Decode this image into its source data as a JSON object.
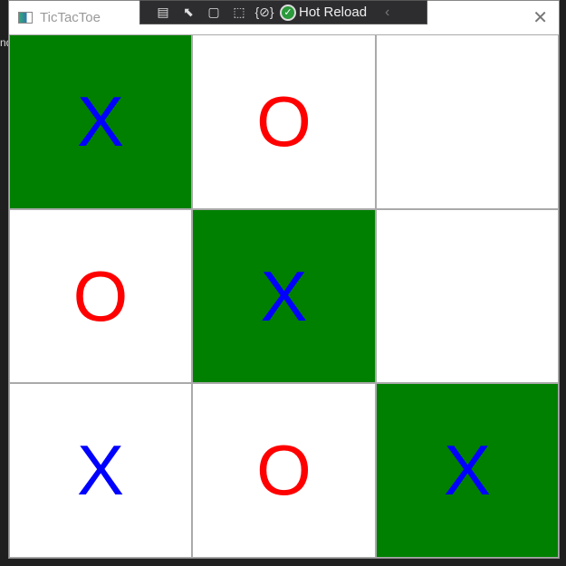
{
  "window": {
    "title": "TicTacToe",
    "close": "✕"
  },
  "background_text": "nd",
  "toolbar": {
    "hot_reload": "Hot Reload",
    "icons": [
      "live-visual-tree-icon",
      "select-element-icon",
      "display-layout-adorners-icon",
      "track-focus-icon",
      "binding-failures-icon"
    ]
  },
  "colors": {
    "win": "#008000",
    "x": "#0000ff",
    "o": "#ff0000"
  },
  "board": [
    {
      "mark": "X",
      "win": true
    },
    {
      "mark": "O",
      "win": false
    },
    {
      "mark": "",
      "win": false
    },
    {
      "mark": "O",
      "win": false
    },
    {
      "mark": "X",
      "win": true
    },
    {
      "mark": "",
      "win": false
    },
    {
      "mark": "X",
      "win": false
    },
    {
      "mark": "O",
      "win": false
    },
    {
      "mark": "X",
      "win": true
    }
  ]
}
